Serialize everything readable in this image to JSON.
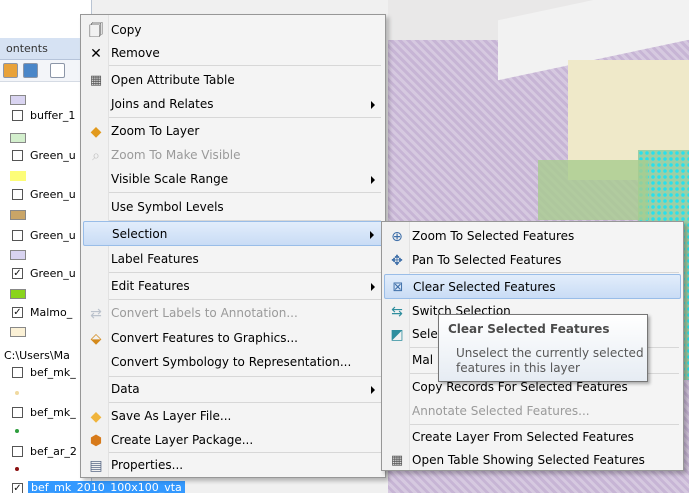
{
  "toc": {
    "title": "ontents",
    "layers": [
      {
        "label": "buffer_1",
        "checked": false
      },
      {
        "label": "Green_u",
        "checked": false
      },
      {
        "label": "Green_u",
        "checked": false
      },
      {
        "label": "Green_u",
        "checked": false
      },
      {
        "label": "Green_u",
        "checked": true
      },
      {
        "label": "Malmo_",
        "checked": true
      }
    ],
    "path": "C:\\Users\\Ma",
    "sublayers": [
      {
        "label": "bef_mk_",
        "checked": false
      },
      {
        "label": "bef_mk_",
        "checked": false
      },
      {
        "label": "bef_ar_2",
        "checked": false
      }
    ],
    "selected_layer": "bef_mk_2010_100x100_vta"
  },
  "context_menu": {
    "items": [
      {
        "label": "Copy",
        "icon": "copy-icon"
      },
      {
        "label": "Remove",
        "icon": "remove-icon"
      },
      {
        "label": "Open Attribute Table",
        "icon": "table-icon"
      },
      {
        "label": "Joins and Relates"
      },
      {
        "label": "Zoom To Layer",
        "icon": "zoom-to-layer-icon"
      },
      {
        "label": "Zoom To Make Visible",
        "icon": "zoom-visible-icon",
        "disabled": true
      },
      {
        "label": "Visible Scale Range"
      },
      {
        "label": "Use Symbol Levels"
      },
      {
        "label": "Selection"
      },
      {
        "label": "Label Features"
      },
      {
        "label": "Edit Features"
      },
      {
        "label": "Convert Labels to Annotation...",
        "icon": "convert-labels-icon",
        "disabled": true
      },
      {
        "label": "Convert Features to Graphics...",
        "icon": "convert-graphics-icon"
      },
      {
        "label": "Convert Symbology to Representation..."
      },
      {
        "label": "Data"
      },
      {
        "label": "Save As Layer File...",
        "icon": "layer-file-icon"
      },
      {
        "label": "Create Layer Package...",
        "icon": "layer-package-icon"
      },
      {
        "label": "Properties...",
        "icon": "properties-icon"
      }
    ]
  },
  "selection_submenu": {
    "items": [
      {
        "label": "Zoom To Selected Features",
        "icon": "zoom-selected-icon"
      },
      {
        "label": "Pan To Selected Features",
        "icon": "pan-selected-icon"
      },
      {
        "label": "Clear Selected Features",
        "icon": "clear-selection-icon"
      },
      {
        "label": "Switch Selection",
        "icon": "switch-selection-icon"
      },
      {
        "label": "Sele",
        "icon": "select-all-icon"
      },
      {
        "label": "Mal"
      },
      {
        "label": "Copy Records For Selected Features"
      },
      {
        "label": "Annotate Selected Features...",
        "disabled": true
      },
      {
        "label": "Create Layer From Selected Features"
      },
      {
        "label": "Open Table Showing Selected Features",
        "icon": "table-icon"
      }
    ]
  },
  "tooltip": {
    "title": "Clear Selected Features",
    "body": "Unselect the currently selected features in this layer"
  },
  "colors": {
    "menu_highlight": "#c9dcf5",
    "highlight_border": "#99bde8",
    "selected_layer_bg": "#3399ff"
  }
}
